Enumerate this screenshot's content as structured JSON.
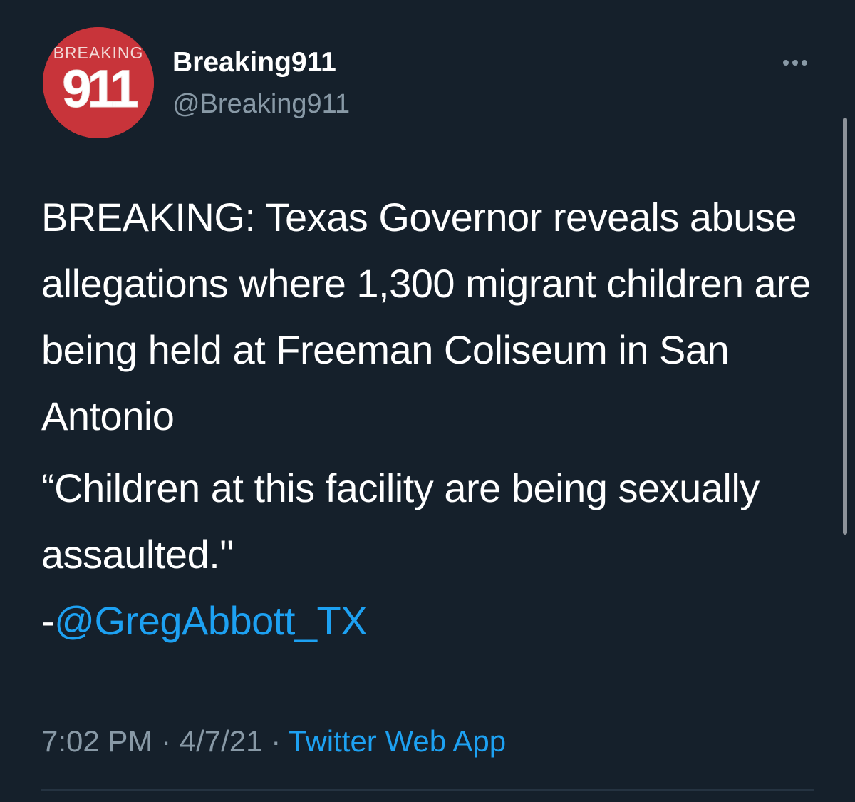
{
  "tweet": {
    "author": {
      "display_name": "Breaking911",
      "handle": "@Breaking911",
      "avatar_text": "BREAKING 911",
      "avatar_color": "#c8343a"
    },
    "menu_icon": "more-horizontal-icon",
    "body": {
      "paragraph1": "BREAKING: Texas Governor reveals abuse allegations where 1,300 migrant children are being held at Freeman Coliseum in San Antonio",
      "quote_line": "“Children at this facility are being sexually assaulted.\"",
      "attribution_prefix": "-",
      "mention": "@GregAbbott_TX"
    },
    "time": "7:02 PM",
    "separator": " · ",
    "date": "4/7/21",
    "source": "Twitter Web App"
  },
  "colors": {
    "background": "#15202b",
    "text": "#ffffff",
    "secondary_text": "#8899a6",
    "link": "#1da1f2",
    "divider": "#253341"
  }
}
